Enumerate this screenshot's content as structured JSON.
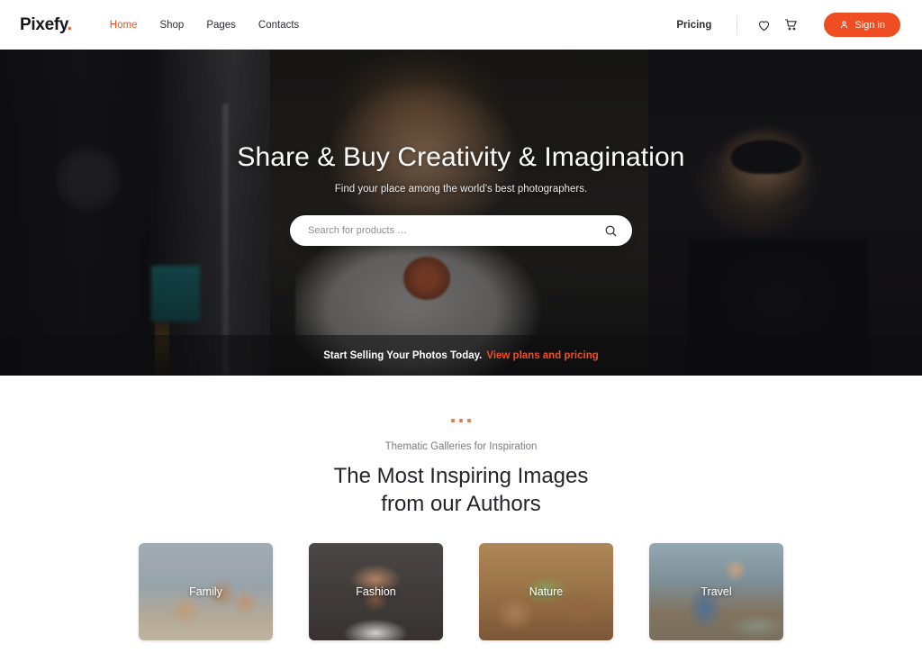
{
  "header": {
    "logo": "Pixefy",
    "logo_dot": ".",
    "nav": [
      {
        "label": "Home",
        "active": true
      },
      {
        "label": "Shop",
        "active": false
      },
      {
        "label": "Pages",
        "active": false
      },
      {
        "label": "Contacts",
        "active": false
      }
    ],
    "pricing_label": "Pricing",
    "wishlist_icon": "heart-icon",
    "cart_icon": "cart-icon",
    "signin_label": "Sign in",
    "signin_icon": "user-icon",
    "accent_color": "#ef4d22"
  },
  "hero": {
    "title": "Share & Buy Creativity & Imagination",
    "subtitle": "Find your place among the world’s best photographers.",
    "search_placeholder": "Search for products …",
    "search_value": "",
    "search_icon": "search-icon",
    "cta_text": "Start Selling Your Photos Today.",
    "cta_link": "View plans and pricing"
  },
  "gallery": {
    "eyebrow": "Thematic Galleries for Inspiration",
    "title_line1": "The Most Inspiring Images",
    "title_line2": "from our Authors",
    "cards": [
      {
        "label": "Family"
      },
      {
        "label": "Fashion"
      },
      {
        "label": "Nature"
      },
      {
        "label": "Travel"
      }
    ]
  }
}
